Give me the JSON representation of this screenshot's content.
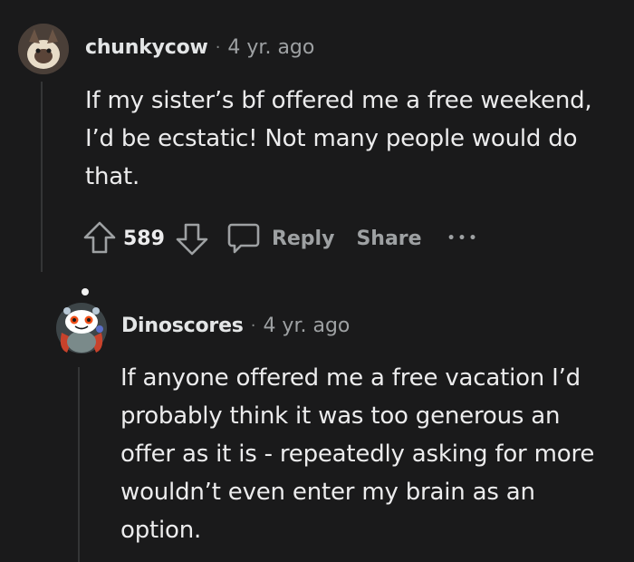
{
  "comments": [
    {
      "username": "chunkycow",
      "separator": "·",
      "age": "4 yr. ago",
      "body_lines": [
        "If my sister’s bf offered me a free weekend,",
        "I’d be ecstatic! Not many people would do",
        "that."
      ],
      "votes": "589",
      "reply_label": "Reply",
      "share_label": "Share",
      "more_label": "•••"
    },
    {
      "username": "Dinoscores",
      "separator": "·",
      "age": "4 yr. ago",
      "body_lines": [
        "If anyone offered me a free vacation I’d",
        "probably think it was too generous an",
        "offer as it is - repeatedly asking for more",
        "wouldn’t even enter my brain as an",
        "option."
      ]
    }
  ],
  "colors": {
    "background": "#1a1a1b",
    "thread_line": "#343536",
    "meta_text": "#9ea1a3",
    "body_text": "#ececed"
  },
  "icons": [
    "avatar-cat",
    "avatar-snoo",
    "upvote-icon",
    "downvote-icon",
    "comment-bubble-icon",
    "more-icon"
  ]
}
